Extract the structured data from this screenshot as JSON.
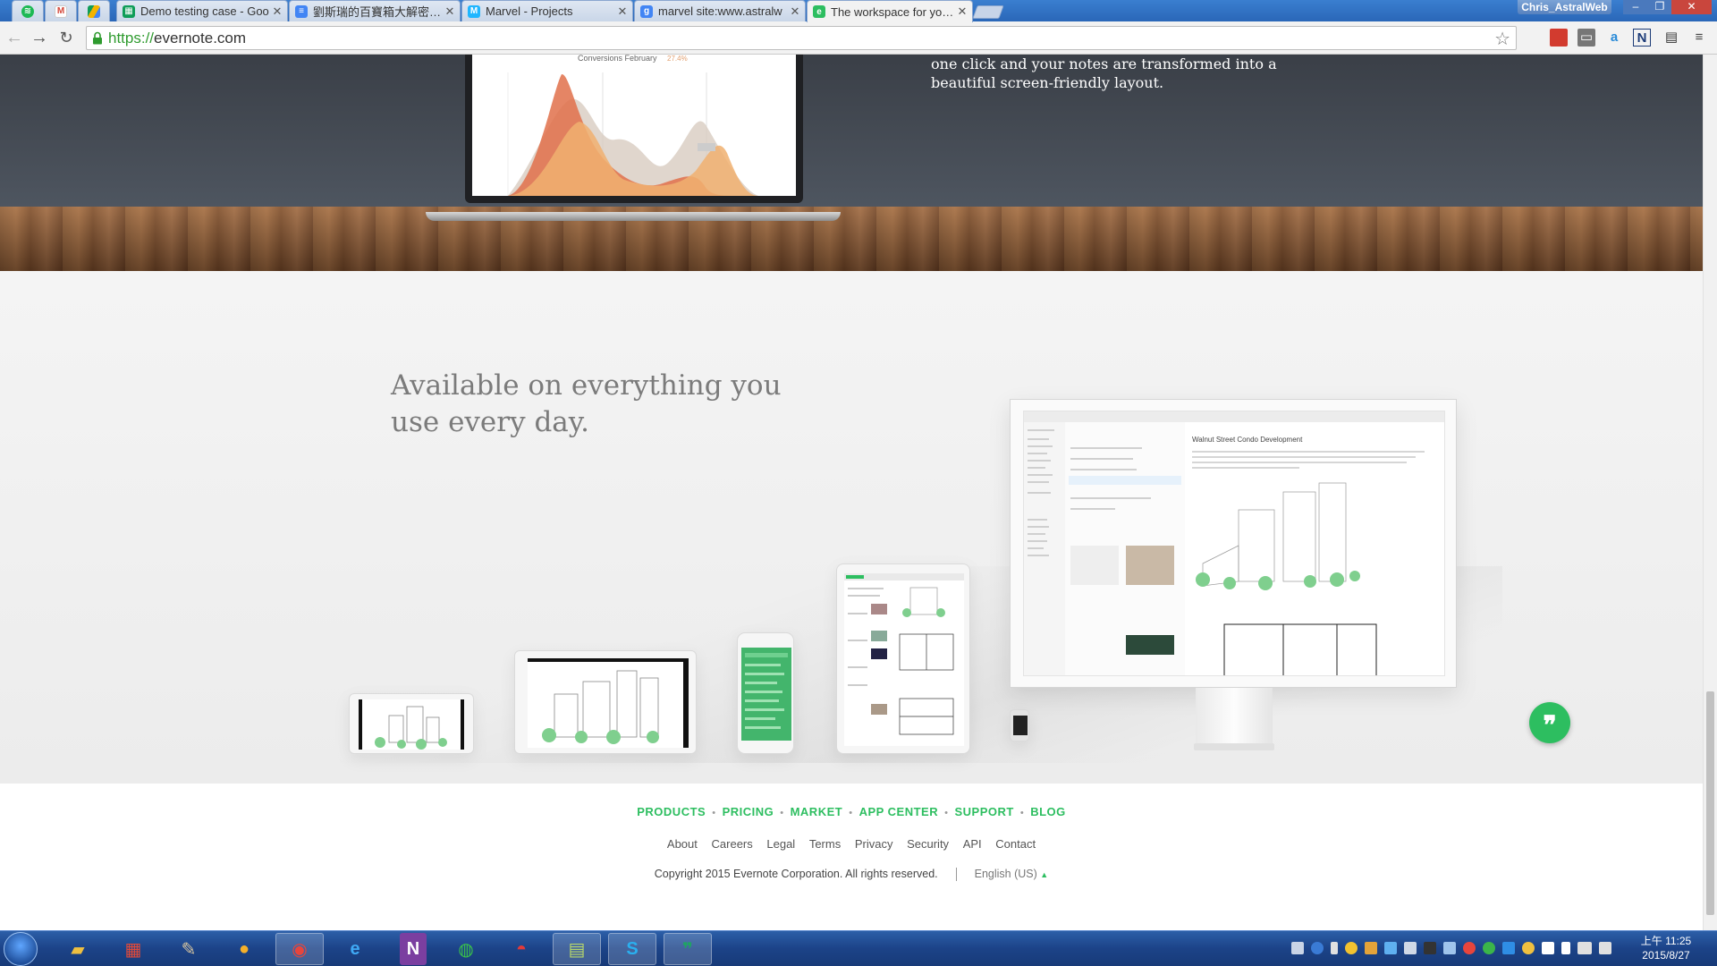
{
  "browser": {
    "tabs": [
      {
        "title": "",
        "icon": "spotify-icon",
        "pinned": true
      },
      {
        "title": "",
        "icon": "gmail-icon",
        "pinned": true
      },
      {
        "title": "",
        "icon": "google-drive-icon",
        "pinned": true
      },
      {
        "title": "Demo testing case - Goo",
        "icon": "google-sheets-icon"
      },
      {
        "title": "劉斯瑞的百寶箱大解密 - G",
        "icon": "google-docs-icon"
      },
      {
        "title": "Marvel - Projects",
        "icon": "marvel-icon"
      },
      {
        "title": "marvel site:www.astralw",
        "icon": "google-search-icon"
      },
      {
        "title": "The workspace for your l",
        "icon": "evernote-icon",
        "active": true
      }
    ],
    "profile_name": "Chris_AstralWeb",
    "url_scheme": "https://",
    "url_host": "evernote.com"
  },
  "hero": {
    "text": "one click and your notes are transformed into a beautiful screen-friendly layout.",
    "chart_title": "Conversions February",
    "chart_value": "27.4%"
  },
  "devices": {
    "headline": "Available on everything you use every day.",
    "monitor_note_title": "Walnut Street Condo Development"
  },
  "footer": {
    "nav": [
      "PRODUCTS",
      "PRICING",
      "MARKET",
      "APP CENTER",
      "SUPPORT",
      "BLOG"
    ],
    "links": [
      "About",
      "Careers",
      "Legal",
      "Terms",
      "Privacy",
      "Security",
      "API",
      "Contact"
    ],
    "copyright": "Copyright 2015 Evernote Corporation. All rights reserved.",
    "language": "English (US)"
  },
  "taskbar": {
    "time": "上午 11:25",
    "date": "2015/8/27",
    "apps": [
      "explorer-icon",
      "apps-grid-icon",
      "paint-icon",
      "color-picker-icon",
      "chrome-icon",
      "internet-explorer-icon",
      "onenote-icon",
      "line-icon",
      "pokeball-icon",
      "notepad-chart-icon",
      "skype-icon",
      "hangouts-icon"
    ]
  },
  "colors": {
    "accent_green": "#2dbe60",
    "taskbar_blue": "#1c4388",
    "tabstrip_blue": "#2a67b8"
  }
}
